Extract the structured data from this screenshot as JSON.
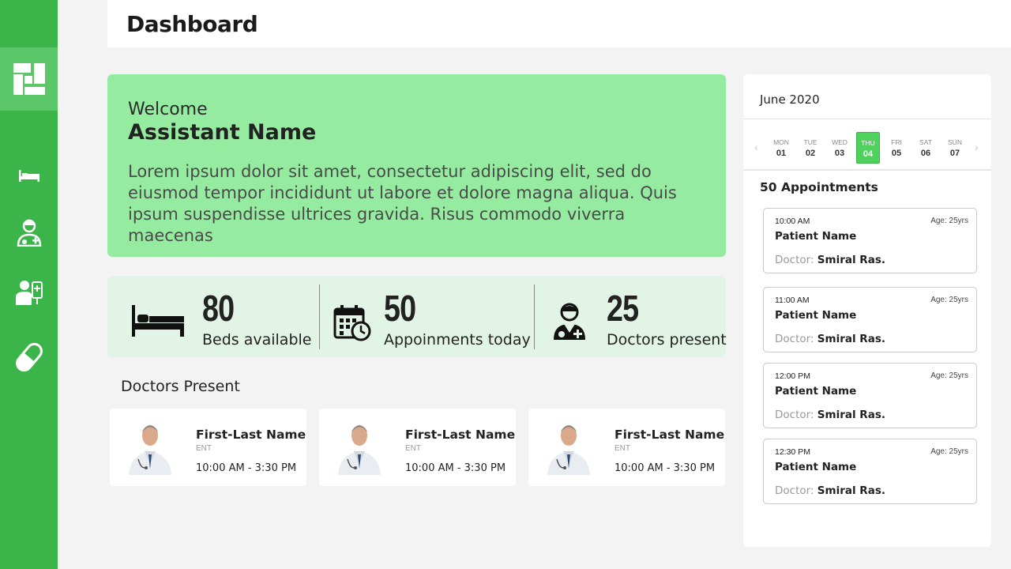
{
  "header": {
    "title": "Dashboard"
  },
  "sidebar": {
    "items": [
      {
        "icon": "dashboard-icon"
      },
      {
        "icon": "bed-icon"
      },
      {
        "icon": "doctor-icon"
      },
      {
        "icon": "patient-icon"
      },
      {
        "icon": "pill-icon"
      }
    ]
  },
  "welcome": {
    "greeting": "Welcome",
    "name": "Assistant Name",
    "text": "Lorem ipsum dolor sit amet, consectetur adipiscing elit, sed do eiusmod tempor incididunt ut labore et dolore magna aliqua. Quis ipsum suspendisse ultrices gravida. Risus commodo viverra maecenas"
  },
  "stats": [
    {
      "value": "80",
      "label": "Beds available",
      "icon": "bed-icon"
    },
    {
      "value": "50",
      "label": "Appoinments today",
      "icon": "calendar-clock-icon"
    },
    {
      "value": "25",
      "label": "Doctors present",
      "icon": "doctor-icon"
    }
  ],
  "doctors": {
    "title": "Doctors Present",
    "list": [
      {
        "name": "First-Last Name",
        "dept": "ENT",
        "time": "10:00 AM - 3:30 PM"
      },
      {
        "name": "First-Last Name",
        "dept": "ENT",
        "time": "10:00 AM - 3:30 PM"
      },
      {
        "name": "First-Last Name",
        "dept": "ENT",
        "time": "10:00 AM - 3:30 PM"
      }
    ]
  },
  "calendar": {
    "month": "June 2020",
    "days": [
      {
        "name": "MON",
        "date": "01"
      },
      {
        "name": "TUE",
        "date": "02"
      },
      {
        "name": "WED",
        "date": "03"
      },
      {
        "name": "THU",
        "date": "04"
      },
      {
        "name": "FRI",
        "date": "05"
      },
      {
        "name": "SAT",
        "date": "06"
      },
      {
        "name": "SUN",
        "date": "07"
      }
    ],
    "selected": "04",
    "prev": "‹",
    "next": "›"
  },
  "appointments": {
    "title": "50 Appointments",
    "doctor_label": "Doctor:",
    "list": [
      {
        "time": "10:00 AM",
        "age": "Age: 25yrs",
        "patient": "Patient Name",
        "doctor": "Smiral Ras."
      },
      {
        "time": "11:00 AM",
        "age": "Age: 25yrs",
        "patient": "Patient Name",
        "doctor": "Smiral Ras."
      },
      {
        "time": "12:00 PM",
        "age": "Age: 25yrs",
        "patient": "Patient Name",
        "doctor": "Smiral Ras."
      },
      {
        "time": "12:30 PM",
        "age": "Age: 25yrs",
        "patient": "Patient Name",
        "doctor": "Smiral Ras."
      }
    ]
  },
  "colors": {
    "sidebar": "#3bb44a",
    "welcome_bg": "#95eca0",
    "stats_bg": "#e2f4e5",
    "accent": "#4fd15d"
  }
}
